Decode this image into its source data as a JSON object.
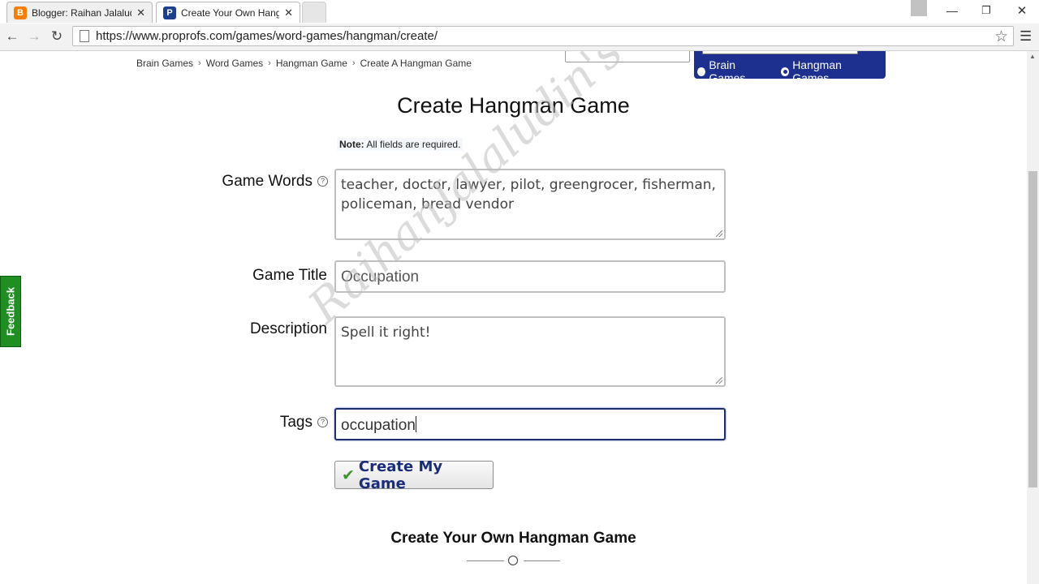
{
  "browser": {
    "tabs": [
      {
        "title": "Blogger: Raihan Jalaludin's",
        "favicon": "blogger-icon",
        "close": "✕"
      },
      {
        "title": "Create Your Own Hangman Game",
        "favicon": "proprofs-icon",
        "close": "✕"
      }
    ],
    "url": "https://www.proprofs.com/games/word-games/hangman/create/"
  },
  "breadcrumb": [
    "Brain Games",
    "Word Games",
    "Hangman Game",
    "Create A Hangman Game"
  ],
  "search": {
    "options": [
      {
        "label": "Brain Games",
        "checked": false
      },
      {
        "label": "Hangman Games",
        "checked": true
      }
    ]
  },
  "form": {
    "title": "Create Hangman Game",
    "note_bold": "Note:",
    "note_text": " All fields are required.",
    "game_words": {
      "label": "Game Words",
      "value": "teacher, doctor, lawyer, pilot, greengrocer, fisherman, policeman, bread vendor"
    },
    "game_title": {
      "label": "Game Title",
      "value": "Occupation"
    },
    "description": {
      "label": "Description",
      "value": "Spell it right!"
    },
    "tags": {
      "label": "Tags",
      "value": "occupation"
    },
    "submit_label": "Create My Game"
  },
  "section_title": "Create Your Own Hangman Game",
  "feedback_label": "Feedback",
  "watermark": "RaihanJalaludin's Blog",
  "colors": {
    "accent": "#1d2f8f",
    "feedback": "#1f8f22",
    "button_text": "#1a2d7a"
  }
}
